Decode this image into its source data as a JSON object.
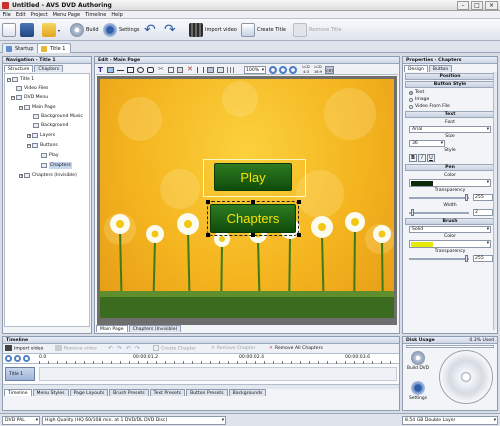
{
  "window": {
    "title": "Untitled - AVS DVD Authoring"
  },
  "menu": [
    "File",
    "Edit",
    "Project",
    "Menu Page",
    "Timeline",
    "Help"
  ],
  "toolbar": {
    "build": "Build",
    "settings": "Settings",
    "import_video": "Import video",
    "create_title": "Create Title",
    "remove_title": "Remove Title"
  },
  "doc_tabs": [
    "Startup",
    "Title 1"
  ],
  "navigation": {
    "header": "Navigation - Title 1",
    "tabs": [
      "Structure",
      "Chapters"
    ],
    "tree": [
      "Title 1",
      "Video Files",
      "DVD Menu",
      "Main Page",
      "Background Music",
      "Background",
      "Layers",
      "Buttons",
      "Play",
      "Chapters",
      "Chapters (Invisible)"
    ]
  },
  "edit": {
    "header": "Edit - Main Page",
    "zoom": "100%",
    "labels": [
      "LCD 4:3",
      "LCD 16:9",
      "CRT"
    ],
    "canvas_buttons": [
      "Play",
      "Chapters"
    ],
    "page_tabs": [
      "Main Page",
      "Chapters (Invisible)"
    ]
  },
  "properties": {
    "header": "Properties - Chapters",
    "tabs": [
      "Design",
      "Button"
    ],
    "sections": {
      "position": "Position",
      "button_style": "Button Style",
      "text": "Text",
      "pen": "Pen",
      "brush": "Brush"
    },
    "style_options": [
      "Text",
      "Image",
      "Video From File"
    ],
    "selected_style": "Text",
    "font_label": "Font",
    "font_value": "Arial",
    "size_label": "Size",
    "size_value": "36",
    "style_label": "Style",
    "style_buttons": [
      "B",
      "I",
      "U"
    ],
    "color_label": "Color",
    "transparency_label": "Transparency",
    "pen_transparency": "255",
    "width_label": "Width",
    "width_value": "2",
    "brush_type": "Solid",
    "brush_color_label": "Color",
    "brush_transparency_label": "Transparency",
    "brush_transparency": "255",
    "colors": {
      "pen": "#0c2a0a",
      "brush": "#e8e80a"
    }
  },
  "timeline": {
    "header": "Timeline",
    "buttons": [
      "Import video",
      "Remove video",
      "Create Chapter",
      "Remove Chapter",
      "Remove All Chapters"
    ],
    "times": [
      "00:00:01.2",
      "00:00:02.4",
      "00:00:03.6"
    ],
    "track_label": "Title 1",
    "ruler_start": "0.0",
    "tabs": [
      "Timeline",
      "Menu Styles",
      "Page Layouts",
      "Brush Presets",
      "Text Presets",
      "Button Presets",
      "Backgrounds"
    ]
  },
  "disk": {
    "header": "Disk Usage",
    "usage": "0.3% Used",
    "build_label": "Build DVD",
    "settings_label": "Settings"
  },
  "status": {
    "format": "DVD PAL",
    "quality": "High Quality (HQ 60/108 min. at 1 DVD/DL DVD Disc)",
    "disc": "8.54 GB Double Layer"
  }
}
